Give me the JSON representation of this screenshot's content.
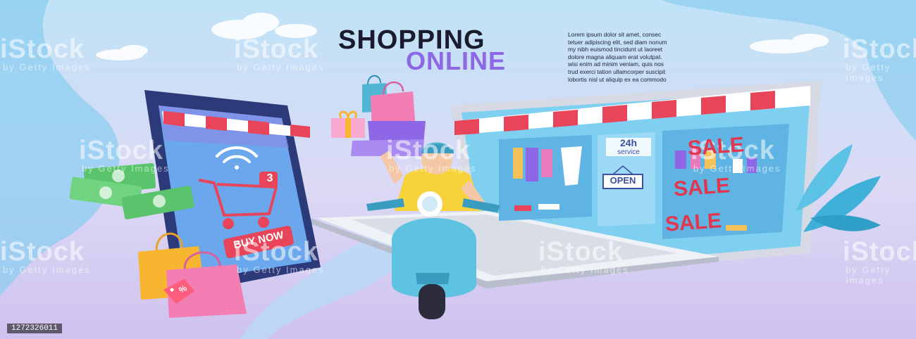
{
  "banner": {
    "title_line1": "SHOPPING",
    "title_line2": "ONLINE",
    "lorem_lines": [
      "Lorem ipsum dolor sit amet, consec",
      "tetuer adipiscing elit, sed diam nonum",
      "my nibh euismod tincidunt ut laoreet",
      "dolore magna aliquam erat volutpat.",
      "wisi enim ad minim veniam, quis nos",
      "trud exerci tation ullamcorper suscipit",
      "lobortis nisl ut aliquip ex ea commodo"
    ]
  },
  "phone": {
    "cart_badge": "3",
    "buy_button": "BUY NOW",
    "wifi_icon": "wifi-icon",
    "cart_icon": "shopping-cart-icon"
  },
  "laptop_shop": {
    "service_label_1": "24h",
    "service_label_2": "service",
    "open_sign": "OPEN",
    "sale_labels": [
      "SALE",
      "SALE",
      "SALE"
    ]
  },
  "price_tag": "%",
  "watermark": {
    "brand": "iStock",
    "sub": "by Getty Images"
  },
  "image_id": "1272326011",
  "colors": {
    "accent_purple": "#8d67e6",
    "sale_red": "#e0374f",
    "scooter_teal": "#4fb6d6",
    "money_green": "#59c46b"
  }
}
